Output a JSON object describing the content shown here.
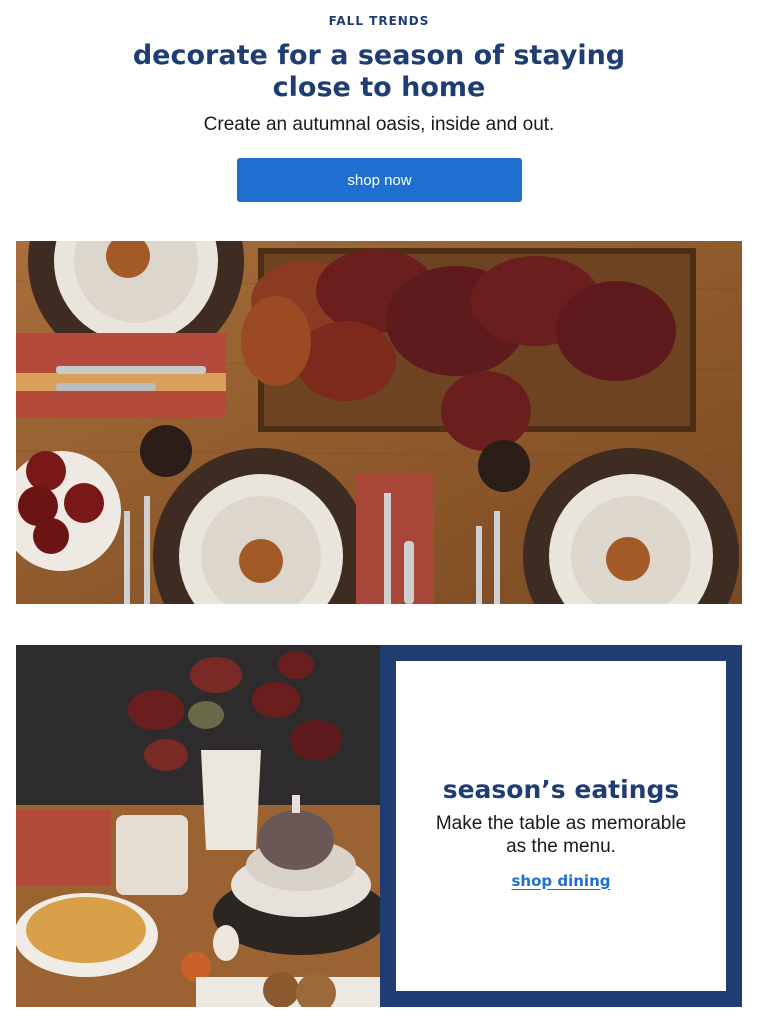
{
  "header": {
    "eyebrow": "FALL TRENDS",
    "headline_line1": "decorate for a season of staying",
    "headline_line2": "close to home",
    "subhead": "Create an autumnal oasis, inside and out.",
    "cta_label": "shop now"
  },
  "promo": {
    "title": "season’s eatings",
    "body": "Make the table as memorable as the menu.",
    "link_label": "shop dining"
  },
  "colors": {
    "brand_navy": "#1f3d73",
    "button_blue": "#1f6fd1",
    "link_blue": "#1f6fd1"
  }
}
